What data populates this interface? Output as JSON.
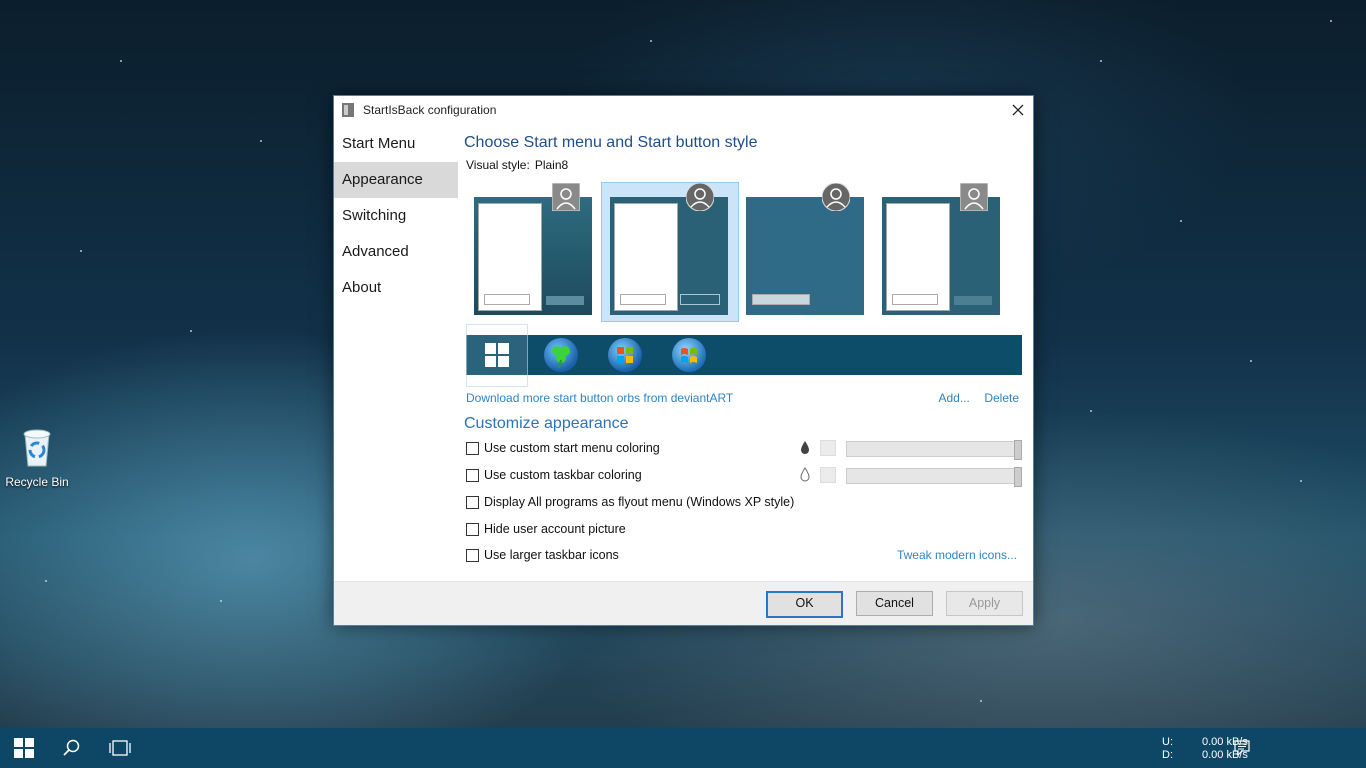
{
  "desktop": {
    "recycle_bin_label": "Recycle Bin"
  },
  "dialog": {
    "title": "StartIsBack configuration",
    "sidebar": [
      {
        "label": "Start Menu",
        "active": false
      },
      {
        "label": "Appearance",
        "active": true
      },
      {
        "label": "Switching",
        "active": false
      },
      {
        "label": "Advanced",
        "active": false
      },
      {
        "label": "About",
        "active": false
      }
    ],
    "heading": "Choose Start menu and Start button style",
    "visual_style_label": "Visual style:",
    "visual_style_value": "Plain8",
    "orbs_link": "Download more start button orbs from deviantART",
    "add_link": "Add...",
    "delete_link": "Delete",
    "customize_heading": "Customize appearance",
    "options": [
      {
        "label": "Use custom start menu coloring",
        "checked": false
      },
      {
        "label": "Use custom taskbar coloring",
        "checked": false
      },
      {
        "label": "Display All programs as flyout menu (Windows XP style)",
        "checked": false
      },
      {
        "label": "Hide user account picture",
        "checked": false
      },
      {
        "label": "Use larger taskbar icons",
        "checked": false
      }
    ],
    "tweak_link": "Tweak modern icons...",
    "buttons": {
      "ok": "OK",
      "cancel": "Cancel",
      "apply": "Apply"
    },
    "colors": {
      "heading": "#1f4e8c",
      "link": "#2e84c8",
      "thumb_dark": "#2a6478",
      "taskbar_orbs": "#0e4d6a"
    }
  },
  "taskbar": {
    "upload_label": "U:",
    "upload_value": "0.00 kB/s",
    "download_label": "D:",
    "download_value": "0.00 kB/s",
    "color": "#0e4766"
  }
}
